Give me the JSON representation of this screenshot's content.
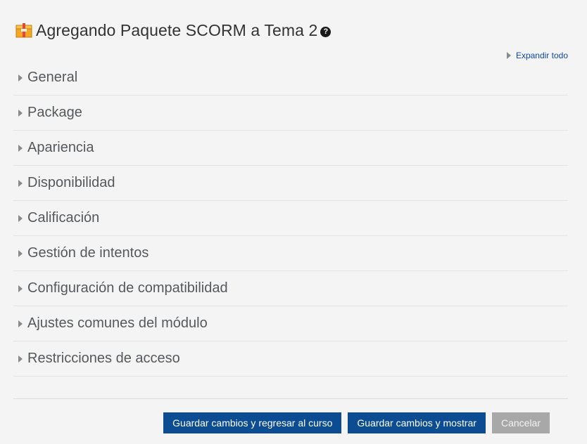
{
  "header": {
    "title": "Agregando Paquete SCORM a Tema 2",
    "help_glyph": "?",
    "title_icon": "package-icon",
    "help_icon": "question-circle-icon"
  },
  "expand_all": {
    "label": "Expandir todo"
  },
  "sections": [
    {
      "label": "General"
    },
    {
      "label": "Package"
    },
    {
      "label": "Apariencia"
    },
    {
      "label": "Disponibilidad"
    },
    {
      "label": "Calificación"
    },
    {
      "label": "Gestión de intentos"
    },
    {
      "label": "Configuración de compatibilidad"
    },
    {
      "label": "Ajustes comunes del módulo"
    },
    {
      "label": "Restricciones de acceso"
    }
  ],
  "actions": {
    "save_return": "Guardar cambios y regresar al curso",
    "save_display": "Guardar cambios y mostrar",
    "cancel": "Cancelar"
  },
  "colors": {
    "primary_button": "#0b4c93",
    "cancel_button": "#a8a8a8",
    "link": "#0f47ad",
    "background": "#f4f4f4"
  }
}
